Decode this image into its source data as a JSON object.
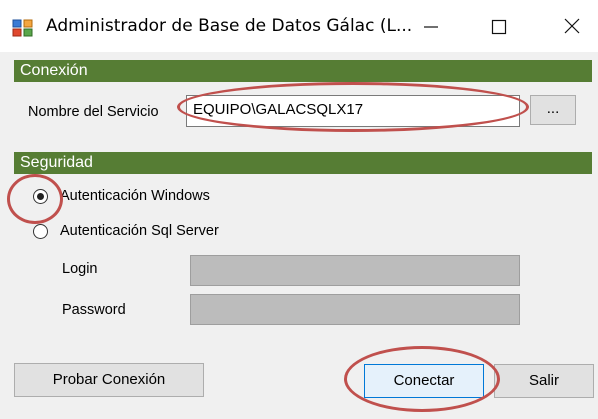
{
  "window": {
    "title": "Administrador de Base de Datos Gálac (L...",
    "controls": {
      "minimize_icon": "minimize-icon",
      "maximize_icon": "maximize-icon",
      "close_icon": "close-icon"
    }
  },
  "conexion": {
    "header": "Conexión",
    "service_label": "Nombre del Servicio",
    "service_value": "EQUIPO\\GALACSQLX17",
    "browse_label": "..."
  },
  "seguridad": {
    "header": "Seguridad",
    "auth_windows_label": "Autenticación Windows",
    "auth_windows_checked": true,
    "auth_sql_label": "Autenticación Sql Server",
    "auth_sql_checked": false,
    "login_label": "Login",
    "login_value": "",
    "password_label": "Password",
    "password_value": ""
  },
  "buttons": {
    "probar": "Probar Conexión",
    "conectar": "Conectar",
    "salir": "Salir"
  },
  "colors": {
    "section_header_bg": "#567d34",
    "annotation": "#c0504d"
  }
}
